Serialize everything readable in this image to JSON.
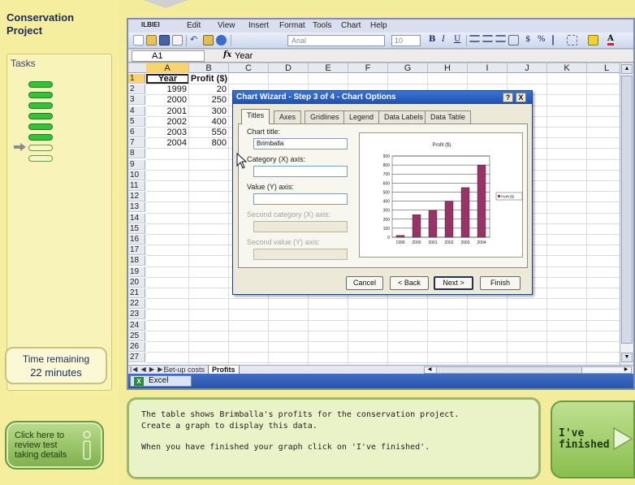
{
  "project": {
    "title": "Conservation Project"
  },
  "tasks": {
    "label": "Tasks",
    "completed": 6,
    "pending": 2
  },
  "timer": {
    "label": "Time remaining",
    "value": "22 minutes"
  },
  "review": {
    "label": "Click here to review test taking details"
  },
  "finished": {
    "label": "I've finished"
  },
  "instructions": {
    "line1": "The table shows Brimballa's profits for the conservation project.",
    "line2": "Create a graph to display this data.",
    "line3": "When you have finished your graph click on 'I've finished'."
  },
  "excel": {
    "menu": {
      "logo": "ILBIEI",
      "edit": "Edit",
      "view": "View",
      "insert": "Insert",
      "format": "Format",
      "tools": "Tools",
      "chart": "Chart",
      "help": "Help"
    },
    "toolbar": {
      "font": "Arial",
      "size": "10",
      "bold": "B",
      "italic": "I",
      "underline": "U",
      "currency": "$",
      "percent": "%"
    },
    "formula": {
      "cell_ref": "A1",
      "fx": "fx",
      "content": "Year"
    },
    "columns": [
      "A",
      "B",
      "C",
      "D",
      "E",
      "F",
      "G",
      "H",
      "I",
      "J",
      "K",
      "L"
    ],
    "rows": [
      "1",
      "2",
      "3",
      "4",
      "5",
      "6",
      "7",
      "8",
      "9",
      "10",
      "11",
      "12",
      "13",
      "14",
      "15",
      "16",
      "17",
      "18",
      "19",
      "20",
      "21",
      "22",
      "23",
      "24",
      "25",
      "26",
      "27"
    ],
    "table": {
      "headers": [
        "Year",
        "Profit ($)"
      ],
      "data": [
        [
          "1999",
          "20"
        ],
        [
          "2000",
          "250"
        ],
        [
          "2001",
          "300"
        ],
        [
          "2002",
          "400"
        ],
        [
          "2003",
          "550"
        ],
        [
          "2004",
          "800"
        ]
      ]
    },
    "sheets": {
      "nav": "|◀ ◀ ▶ ▶|",
      "setup": "Set-up costs",
      "profits": "Profits"
    },
    "taskbar": {
      "app": "Excel"
    }
  },
  "dialog": {
    "title": "Chart Wizard - Step 3 of 4 - Chart Options",
    "help_btn": "?",
    "close_btn": "X",
    "tabs": [
      "Titles",
      "Axes",
      "Gridlines",
      "Legend",
      "Data Labels",
      "Data Table"
    ],
    "chart_title_label": "Chart title:",
    "chart_title_value": "Brimballa",
    "category_label": "Category (X) axis:",
    "value_label": "Value (Y) axis:",
    "second_category_label": "Second category (X) axis:",
    "second_value_label": "Second value (Y) axis:",
    "buttons": {
      "cancel": "Cancel",
      "back": "< Back",
      "next": "Next >",
      "finish": "Finish"
    }
  },
  "chart_data": {
    "type": "bar",
    "title": "Profit ($)",
    "categories": [
      "1999",
      "2000",
      "2001",
      "2002",
      "2003",
      "2004"
    ],
    "series": [
      {
        "name": "Profit ($)",
        "values": [
          20,
          250,
          300,
          400,
          550,
          800
        ]
      }
    ],
    "yticks": [
      "0",
      "100",
      "200",
      "300",
      "400",
      "500",
      "600",
      "700",
      "800",
      "900"
    ],
    "ylim": [
      0,
      900
    ],
    "grid": true,
    "legend": "right",
    "bar_color": "#993366"
  }
}
